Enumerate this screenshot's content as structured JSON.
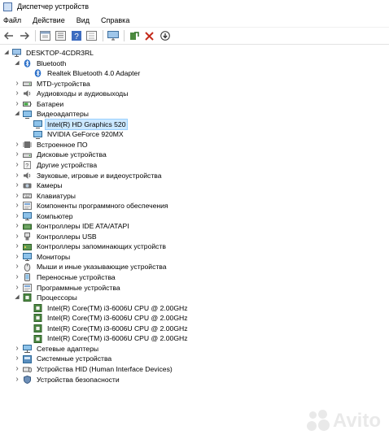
{
  "window": {
    "title": "Диспетчер устройств"
  },
  "menu": [
    "Файл",
    "Действие",
    "Вид",
    "Справка"
  ],
  "toolbar": [
    "back-icon",
    "forward-icon",
    "properties-icon",
    "list-icon",
    "help-icon",
    "view-icon",
    "monitor-icon",
    "update-driver-icon",
    "remove-icon",
    "download-icon"
  ],
  "tree": [
    {
      "label": "DESKTOP-4CDR3RL",
      "level": 0,
      "exp": "open",
      "icon": "computer"
    },
    {
      "label": "Bluetooth",
      "level": 1,
      "exp": "open",
      "icon": "bluetooth"
    },
    {
      "label": "Realtek Bluetooth 4.0 Adapter",
      "level": 2,
      "exp": "",
      "icon": "bluetooth"
    },
    {
      "label": "MTD-устройства",
      "level": 1,
      "exp": "closed",
      "icon": "drive"
    },
    {
      "label": "Аудиовходы и аудиовыходы",
      "level": 1,
      "exp": "closed",
      "icon": "audio"
    },
    {
      "label": "Батареи",
      "level": 1,
      "exp": "closed",
      "icon": "battery"
    },
    {
      "label": "Видеоадаптеры",
      "level": 1,
      "exp": "open",
      "icon": "display"
    },
    {
      "label": "Intel(R) HD Graphics 520",
      "level": 2,
      "exp": "",
      "icon": "display",
      "selected": true
    },
    {
      "label": "NVIDIA GeForce 920MX",
      "level": 2,
      "exp": "",
      "icon": "display"
    },
    {
      "label": "Встроенное ПО",
      "level": 1,
      "exp": "closed",
      "icon": "chip"
    },
    {
      "label": "Дисковые устройства",
      "level": 1,
      "exp": "closed",
      "icon": "drive"
    },
    {
      "label": "Другие устройства",
      "level": 1,
      "exp": "closed",
      "icon": "unknown"
    },
    {
      "label": "Звуковые, игровые и видеоустройства",
      "level": 1,
      "exp": "closed",
      "icon": "audio"
    },
    {
      "label": "Камеры",
      "level": 1,
      "exp": "closed",
      "icon": "camera"
    },
    {
      "label": "Клавиатуры",
      "level": 1,
      "exp": "closed",
      "icon": "keyboard"
    },
    {
      "label": "Компоненты программного обеспечения",
      "level": 1,
      "exp": "closed",
      "icon": "software"
    },
    {
      "label": "Компьютер",
      "level": 1,
      "exp": "closed",
      "icon": "monitor"
    },
    {
      "label": "Контроллеры IDE ATA/ATAPI",
      "level": 1,
      "exp": "closed",
      "icon": "controller"
    },
    {
      "label": "Контроллеры USB",
      "level": 1,
      "exp": "closed",
      "icon": "usb"
    },
    {
      "label": "Контроллеры запоминающих устройств",
      "level": 1,
      "exp": "closed",
      "icon": "storage"
    },
    {
      "label": "Мониторы",
      "level": 1,
      "exp": "closed",
      "icon": "monitor"
    },
    {
      "label": "Мыши и иные указывающие устройства",
      "level": 1,
      "exp": "closed",
      "icon": "mouse"
    },
    {
      "label": "Переносные устройства",
      "level": 1,
      "exp": "closed",
      "icon": "portable"
    },
    {
      "label": "Программные устройства",
      "level": 1,
      "exp": "closed",
      "icon": "software"
    },
    {
      "label": "Процессоры",
      "level": 1,
      "exp": "open",
      "icon": "cpu"
    },
    {
      "label": "Intel(R) Core(TM) i3-6006U CPU @ 2.00GHz",
      "level": 2,
      "exp": "",
      "icon": "cpu"
    },
    {
      "label": "Intel(R) Core(TM) i3-6006U CPU @ 2.00GHz",
      "level": 2,
      "exp": "",
      "icon": "cpu"
    },
    {
      "label": "Intel(R) Core(TM) i3-6006U CPU @ 2.00GHz",
      "level": 2,
      "exp": "",
      "icon": "cpu"
    },
    {
      "label": "Intel(R) Core(TM) i3-6006U CPU @ 2.00GHz",
      "level": 2,
      "exp": "",
      "icon": "cpu"
    },
    {
      "label": "Сетевые адаптеры",
      "level": 1,
      "exp": "closed",
      "icon": "network"
    },
    {
      "label": "Системные устройства",
      "level": 1,
      "exp": "closed",
      "icon": "system"
    },
    {
      "label": "Устройства HID (Human Interface Devices)",
      "level": 1,
      "exp": "closed",
      "icon": "hid"
    },
    {
      "label": "Устройства безопасности",
      "level": 1,
      "exp": "closed",
      "icon": "security"
    }
  ],
  "watermark": {
    "text": "Avito"
  }
}
